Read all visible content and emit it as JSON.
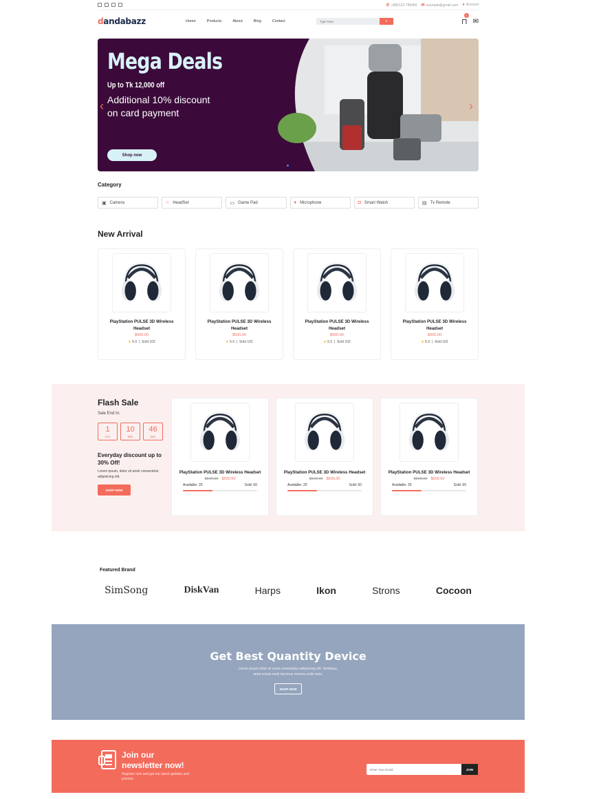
{
  "colors": {
    "accent": "#f36b5b",
    "hero_bg": "#3b0a3a",
    "promo_bg": "#95a5bd",
    "flash_bg": "#fbf0ef"
  },
  "topbar": {
    "social_icons": [
      "instagram-icon",
      "facebook-icon",
      "twitter-icon",
      "linkedin-icon"
    ],
    "phone": "+880123-789456",
    "email": "example@gmail.com",
    "account": "Account"
  },
  "header": {
    "logo_accent": "d",
    "logo_rest": "andabazz",
    "nav": [
      "Home",
      "Products",
      "About",
      "Blog",
      "Contact"
    ],
    "search_placeholder": "Type here",
    "cart_count": "2"
  },
  "hero": {
    "title": "Mega Deals",
    "subtitle": "Up to Tk 12,000 off",
    "desc_line1": "Additional 10% discount",
    "desc_line2": "on card payment",
    "button": "Shop now"
  },
  "category": {
    "title": "Category",
    "items": [
      {
        "label": "Camera",
        "icon": "camera-icon"
      },
      {
        "label": "HeadSet",
        "icon": "headset-icon"
      },
      {
        "label": "Game Pad",
        "icon": "gamepad-icon"
      },
      {
        "label": "Microphone",
        "icon": "microphone-icon"
      },
      {
        "label": "Smart Watch",
        "icon": "watch-icon"
      },
      {
        "label": "Tv Remote",
        "icon": "remote-icon"
      }
    ]
  },
  "new_arrival": {
    "title": "New Arrival",
    "products": [
      {
        "name": "PlayStation PULSE 3D Wireless Headset",
        "price": "$500.00",
        "rating": "5.0",
        "sold": "Sold 102"
      },
      {
        "name": "PlayStation PULSE 3D Wireless Headset",
        "price": "$500.00",
        "rating": "5.0",
        "sold": "Sold 102"
      },
      {
        "name": "PlayStation PULSE 3D Wireless Headset",
        "price": "$500.00",
        "rating": "5.0",
        "sold": "Sold 102"
      },
      {
        "name": "PlayStation PULSE 3D Wireless Headset",
        "price": "$500.00",
        "rating": "5.0",
        "sold": "Sold 102"
      }
    ]
  },
  "flash_sale": {
    "title": "Flash Sale",
    "ends_label": "Sale End In:",
    "timer": [
      {
        "value": "1",
        "unit": "Hrs"
      },
      {
        "value": "10",
        "unit": "Min"
      },
      {
        "value": "46",
        "unit": "Sec"
      }
    ],
    "offer_title": "Everyday discount up to 30% Off!",
    "offer_text": "Lorem ipsum, dolor sit amet consectetur adipisicing elit.",
    "button": "SHOP NOW",
    "products": [
      {
        "name": "PlayStation PULSE 3D Wireless Headset",
        "old_price": "$500.00",
        "price": "$500.00",
        "available": "Available: 20",
        "sold": "Sold: 60",
        "progress": 0.4
      },
      {
        "name": "PlayStation PULSE 3D Wireless Headset",
        "old_price": "$500.00",
        "price": "$500.00",
        "available": "Available: 20",
        "sold": "Sold: 60",
        "progress": 0.4
      },
      {
        "name": "PlayStation PULSE 3D Wireless Headset",
        "old_price": "$500.00",
        "price": "$500.00",
        "available": "Available: 20",
        "sold": "Sold: 60",
        "progress": 0.4
      }
    ]
  },
  "featured_brand": {
    "title": "Featured Brand",
    "brands": [
      "SimSong",
      "DiskVan",
      "Harps",
      "Ikon",
      "Strons",
      "Cocoon"
    ]
  },
  "promo": {
    "title": "Get Best Quantity Device",
    "text_line1": "Lorem ipsum dolor sit amet consectetur adipisicing elit. Similique,",
    "text_line2": "amet soluta modi ducimus minima unde iusto.",
    "button": "SHOP NOW"
  },
  "newsletter": {
    "title_line1": "Join our",
    "title_line2": "newsletter now!",
    "text": "Register now and get our latest updates and promos.",
    "placeholder": "Enter Your Email",
    "button": "JOIN"
  }
}
